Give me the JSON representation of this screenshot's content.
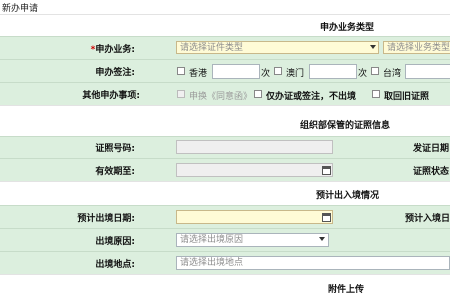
{
  "window": {
    "title": "新办申请"
  },
  "sections": {
    "business_type": "申办业务类型",
    "certificate_info": "组织部保管的证照信息",
    "exit_entry": "预计出入境情况",
    "attachments": "附件上传"
  },
  "form": {
    "business": {
      "required_mark": "*",
      "label": "申办业务:",
      "cert_type_placeholder": "请选择证件类型",
      "business_type_placeholder": "请选择业务类型"
    },
    "endorsement": {
      "label": "申办签注:",
      "hk_label": "香港",
      "macau_label": "澳门",
      "taiwan_label": "台湾",
      "times_unit": "次"
    },
    "other": {
      "label": "其他申办事项:",
      "option1": "申换《同意函》",
      "option2": "仅办证或签注，不出境",
      "option3": "取回旧证照"
    },
    "cert_number": {
      "label": "证照号码:",
      "right_label": "发证日期"
    },
    "valid_until": {
      "label": "有效期至:",
      "right_label": "证照状态"
    },
    "exit_date": {
      "label": "预计出境日期:",
      "right_label": "预计入境日期"
    },
    "exit_reason": {
      "label": "出境原因:",
      "placeholder": "请选择出境原因"
    },
    "exit_place": {
      "label": "出境地点:",
      "placeholder": "请选择出境地点"
    }
  },
  "colors": {
    "row_bg": "#dcefde",
    "required": "#d00000",
    "highlight_field": "#fffbd6"
  }
}
